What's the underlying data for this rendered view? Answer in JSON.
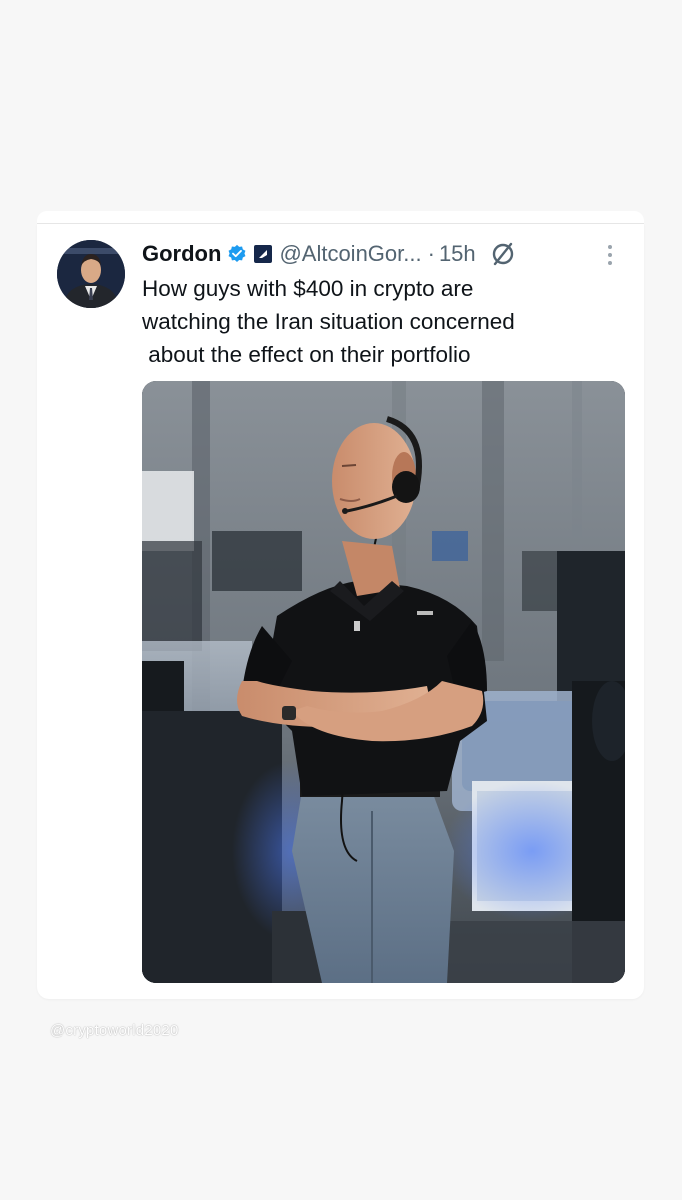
{
  "tweet": {
    "display_name": "Gordon",
    "handle": "@AltcoinGor...",
    "separator": "·",
    "time": "15h",
    "text_lines": [
      "How guys with $400 in crypto are",
      "watching the Iran situation concerned",
      " about the effect on their portfolio"
    ],
    "media_description_icon": "photo-of-man-with-headset-in-control-room"
  },
  "icons": {
    "verified": "verified-badge-icon",
    "affiliate": "affiliate-badge-icon",
    "grok": "grok-icon",
    "more": "more-options-icon"
  },
  "watermark": {
    "text": "@cryptoworld2020"
  },
  "colors": {
    "background": "#f7f7f7",
    "card": "#ffffff",
    "text_primary": "#0f1419",
    "text_secondary": "#536471",
    "verified_blue": "#1d9bf0"
  }
}
